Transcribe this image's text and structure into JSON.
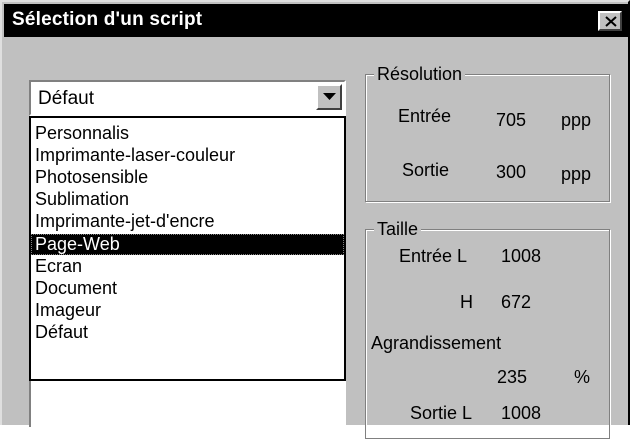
{
  "window": {
    "title": "Sélection d'un script"
  },
  "script_combo": {
    "selected": "Défaut",
    "options": [
      "Personnalis",
      "Imprimante-laser-couleur",
      "Photosensible",
      "Sublimation",
      "Imprimante-jet-d'encre",
      "Page-Web",
      "Ecran",
      "Document",
      "Imageur",
      "Défaut"
    ],
    "highlighted": "Page-Web"
  },
  "resolution": {
    "label": "Résolution",
    "input_label": "Entrée",
    "input_value": "705",
    "input_unit": "ppp",
    "output_label": "Sortie",
    "output_value": "300",
    "output_unit": "ppp"
  },
  "size": {
    "label": "Taille",
    "input_w_label": "Entrée L",
    "input_w_value": "1008",
    "input_h_label": "H",
    "input_h_value": "672",
    "enlarge_label": "Agrandissement",
    "enlarge_value": "235",
    "enlarge_unit": "%",
    "output_w_label": "Sortie L",
    "output_w_value": "1008"
  },
  "icons": {
    "close": "close-icon",
    "dropdown_arrow": "chevron-down-icon"
  }
}
